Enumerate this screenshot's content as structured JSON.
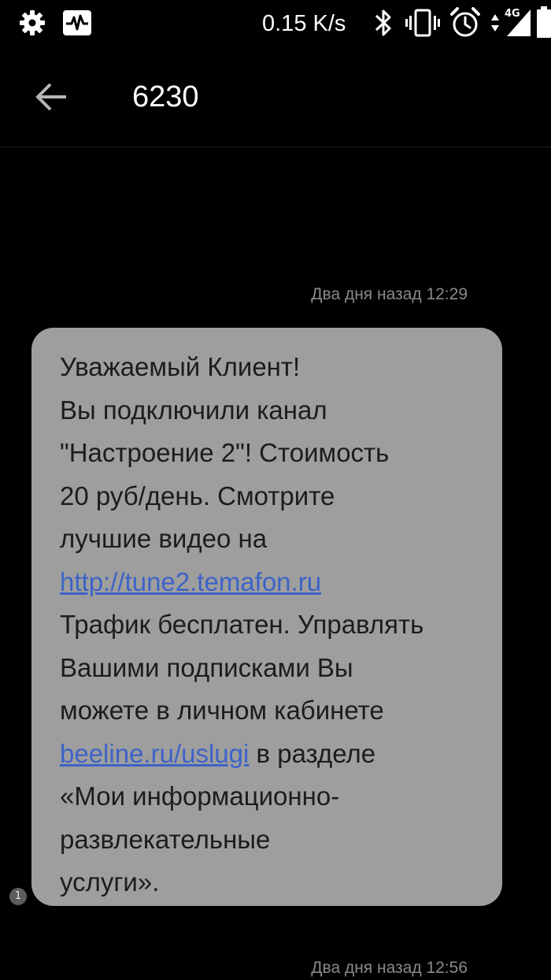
{
  "status_bar": {
    "speed_text": "0.15 K/s",
    "network_label": "4G",
    "icons": [
      "settings-gear-icon",
      "activity-monitor-icon",
      "bluetooth-icon",
      "vibrate-icon",
      "alarm-clock-icon",
      "data-arrows-icon",
      "signal-strength-icon",
      "battery-icon"
    ]
  },
  "toolbar": {
    "back_icon": "arrow-back-icon",
    "title": "6230"
  },
  "messages": [
    {
      "timestamp": "Два дня назад 12:29",
      "lines": {
        "l1": "Уважаемый Клиент!",
        "l2": "Вы подключили канал",
        "l3": "\"Настроение 2\"! Стоимость",
        "l4": "20 руб/день. Смотрите",
        "l5": "лучшие видео на",
        "link1": "http://tune2.temafon.ru",
        "l7": "Трафик бесплатен. Управлять",
        "l8": "Вашими подписками Вы",
        "l9": "можете в личном кабинете",
        "link2": "beeline.ru/uslugi",
        "l10_rest": " в разделе",
        "l11": "«Мои информационно-",
        "l12": "развлекательные",
        "l13": "услуги»."
      },
      "sim_badge": "1",
      "bubble_color": "#9e9e9e",
      "link_color": "#3d63c7"
    },
    {
      "timestamp": "Два дня назад 12:56"
    }
  ]
}
